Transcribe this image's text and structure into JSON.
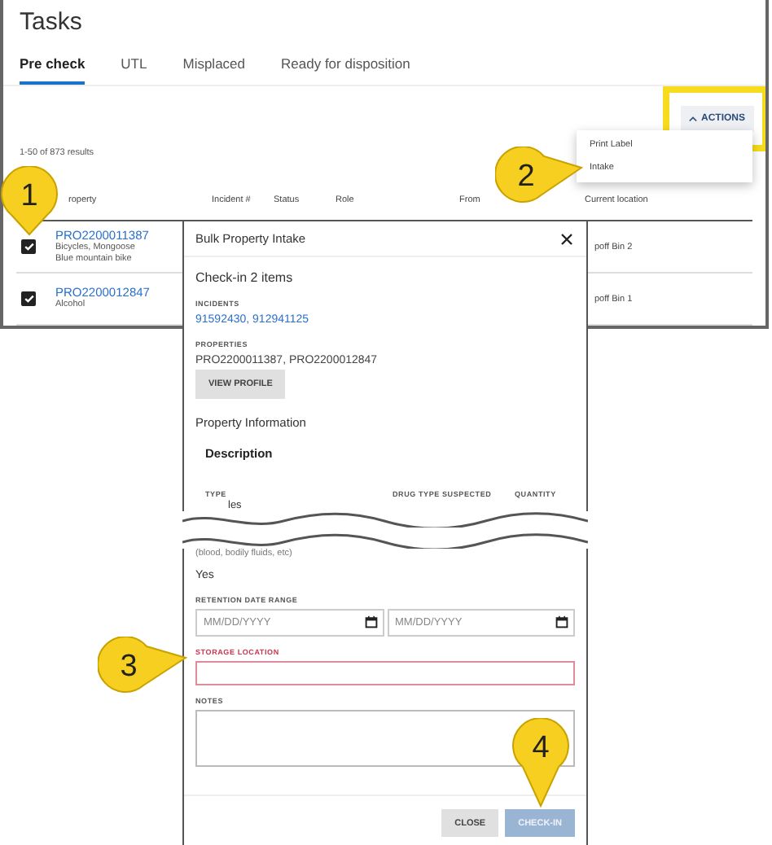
{
  "page": {
    "title": "Tasks",
    "tabs": [
      {
        "label": "Pre check",
        "selected": true
      },
      {
        "label": "UTL",
        "selected": false
      },
      {
        "label": "Misplaced",
        "selected": false
      },
      {
        "label": "Ready for disposition",
        "selected": false
      }
    ],
    "actions_button": {
      "label": "ACTIONS",
      "highlighted": true
    },
    "actions_menu": [
      "Print Label",
      "Intake"
    ],
    "results_count": "1-50 of 873 results",
    "table": {
      "columns": [
        "roperty",
        "Incident #",
        "Status",
        "Role",
        "From",
        "Current location"
      ],
      "rows": [
        {
          "checked": true,
          "property": "PRO2200011387",
          "details": [
            "Bicycles, Mongoose",
            "Blue mountain bike"
          ],
          "current_location": "poff Bin 2"
        },
        {
          "checked": true,
          "property": "PRO2200012847",
          "details": [
            "Alcohol"
          ],
          "current_location": "poff Bin 1"
        }
      ]
    }
  },
  "dialog": {
    "title": "Bulk Property Intake",
    "heading": "Check-in 2 items",
    "incidents_label": "INCIDENTS",
    "incidents": "91592430, 912941125",
    "properties_label": "PROPERTIES",
    "properties": "PRO2200011387, PRO2200012847",
    "view_profile_button": "VIEW PROFILE",
    "section_title": "Property Information",
    "subsection_title": "Description",
    "description_columns": [
      "TYPE",
      "DRUG TYPE SUSPECTED",
      "QUANTITY"
    ],
    "type_value": "les",
    "hint": "(blood, bodily fluids, etc)",
    "answer": "Yes",
    "retention_label": "RETENTION DATE RANGE",
    "date_fields": [
      {
        "placeholder": "MM/DD/YYYY"
      },
      {
        "placeholder": "MM/DD/YYYY"
      }
    ],
    "storage_label": "STORAGE LOCATION",
    "storage_invalid": true,
    "notes_label": "NOTES",
    "buttons": [
      {
        "label": "CLOSE",
        "kind": "secondary"
      },
      {
        "label": "CHECK-IN",
        "kind": "primary"
      }
    ]
  },
  "callouts": [
    {
      "number": "1"
    },
    {
      "number": "2"
    },
    {
      "number": "3"
    },
    {
      "number": "4"
    }
  ]
}
